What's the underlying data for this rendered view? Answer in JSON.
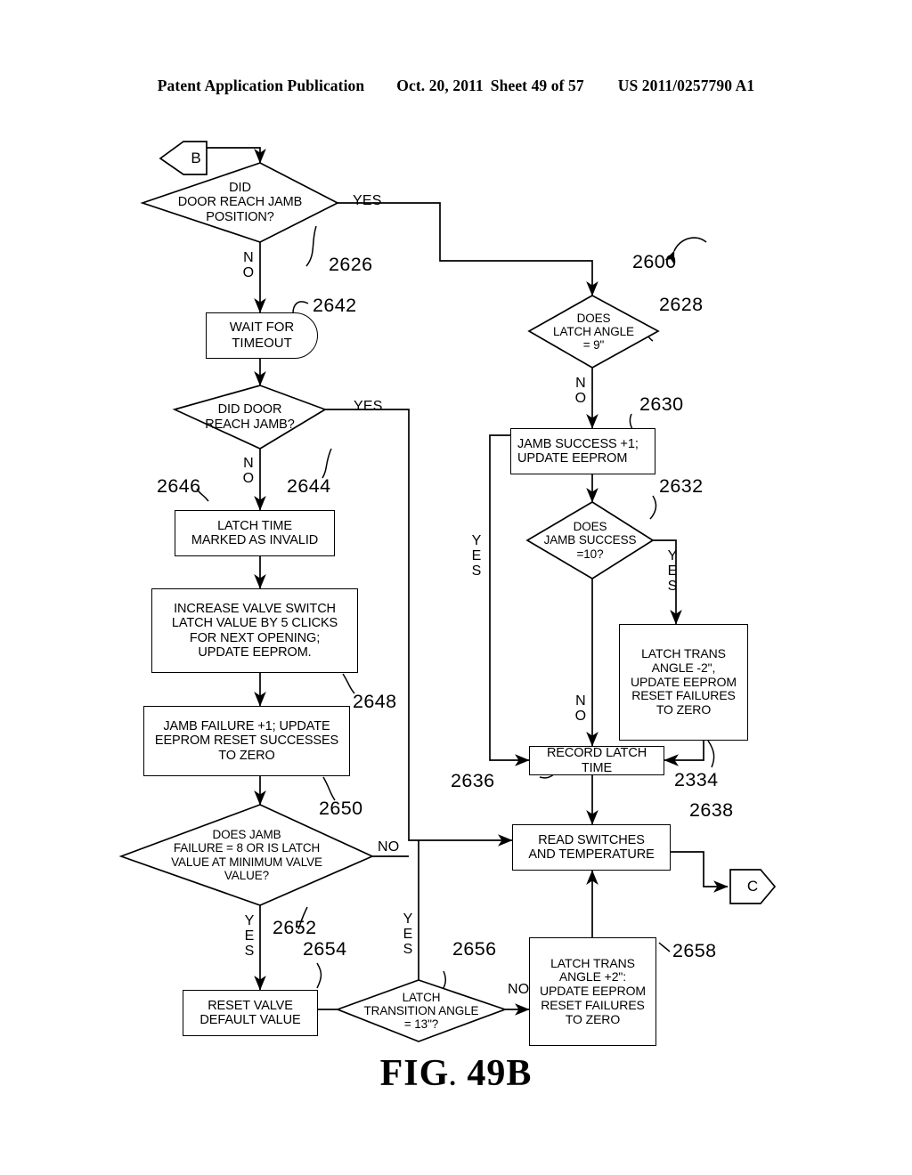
{
  "header": {
    "publication": "Patent Application Publication",
    "date": "Oct. 20, 2011",
    "sheet": "Sheet 49 of 57",
    "docnum": "US 2011/0257790 A1"
  },
  "figure": {
    "caption_prefix": "FIG",
    "caption_dot": ".",
    "caption_number": "49B"
  },
  "connectors": [
    {
      "id": "B",
      "label": "B"
    },
    {
      "id": "C",
      "label": "C"
    }
  ],
  "nodes": {
    "did_door_reach_jamb_position": "DID\nDOOR REACH JAMB\nPOSITION?",
    "wait_for_timeout": "WAIT  FOR\nTIMEOUT",
    "did_door_reach_jamb": "DID DOOR\nREACH JAMB?",
    "latch_time_invalid": "LATCH TIME\nMARKED AS INVALID",
    "increase_valve_switch": "INCREASE VALVE SWITCH\nLATCH VALUE BY 5 CLICKS\nFOR NEXT OPENING;\nUPDATE EEPROM.",
    "jamb_failure": "JAMB FAILURE +1; UPDATE\nEEPROM RESET SUCCESSES\nTO ZERO",
    "does_jamb_failure": "DOES JAMB\nFAILURE = 8 OR IS LATCH\nVALUE AT MINIMUM  VALVE\nVALUE?",
    "reset_valve_default": "RESET VALVE\nDEFAULT VALUE",
    "latch_transition_angle": "LATCH\nTRANSITION ANGLE\n= 13\"?",
    "does_latch_angle": "DOES\nLATCH ANGLE\n= 9\"",
    "jamb_success": "JAMB SUCCESS +1;\nUPDATE EEPROM",
    "does_jamb_success": "DOES\nJAMB SUCCESS\n=10?",
    "latch_trans_angle_minus": "LATCH TRANS\nANGLE -2\",\nUPDATE EEPROM\nRESET FAILURES\nTO ZERO",
    "record_latch_time": "RECORD LATCH TIME",
    "read_switches": "READ SWITCHES\nAND TEMPERATURE",
    "latch_trans_angle_plus": "LATCH TRANS\nANGLE +2\":\nUPDATE EEPROM\nRESET FAILURES\nTO ZERO"
  },
  "branch_labels": {
    "yes_2626": "YES",
    "no_2626": "NO",
    "yes_2644": "YES",
    "no_2644": "NO",
    "no_2628": "NO",
    "yes_left_2636": "YES",
    "yes_right_2632": "YES",
    "no_2632": "NO",
    "no_2652": "NO",
    "yes_2652": "YES",
    "yes_2656": "YES",
    "no_2656": "NO"
  },
  "reference_numerals": {
    "n2600": "2600",
    "n2626": "2626",
    "n2628": "2628",
    "n2630": "2630",
    "n2632": "2632",
    "n2334": "2334",
    "n2636": "2636",
    "n2638": "2638",
    "n2642": "2642",
    "n2644": "2644",
    "n2646": "2646",
    "n2648": "2648",
    "n2650": "2650",
    "n2652": "2652",
    "n2654": "2654",
    "n2656": "2656",
    "n2658": "2658"
  },
  "style": {
    "ink": "#000000",
    "paper": "#ffffff"
  }
}
